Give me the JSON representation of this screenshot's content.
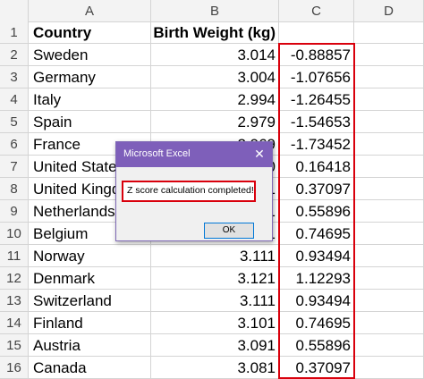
{
  "columns": [
    "A",
    "B",
    "C",
    "D"
  ],
  "rows": [
    {
      "num": "1",
      "a": "Country",
      "b": "Birth Weight (kg)",
      "c": ""
    },
    {
      "num": "2",
      "a": "Sweden",
      "b": "3.014",
      "c": "-0.88857"
    },
    {
      "num": "3",
      "a": "Germany",
      "b": "3.004",
      "c": "-1.07656"
    },
    {
      "num": "4",
      "a": "Italy",
      "b": "2.994",
      "c": "-1.26455"
    },
    {
      "num": "5",
      "a": "Spain",
      "b": "2.979",
      "c": "-1.54653"
    },
    {
      "num": "6",
      "a": "France",
      "b": "2.969",
      "c": "-1.73452"
    },
    {
      "num": "7",
      "a": "United States",
      "b": "3.060",
      "c": "0.16418"
    },
    {
      "num": "8",
      "a": "United Kingdom",
      "b": "3.071",
      "c": "0.37097"
    },
    {
      "num": "9",
      "a": "Netherlands",
      "b": "3.081",
      "c": "0.55896"
    },
    {
      "num": "10",
      "a": "Belgium",
      "b": "3.091",
      "c": "0.74695"
    },
    {
      "num": "11",
      "a": "Norway",
      "b": "3.111",
      "c": "0.93494"
    },
    {
      "num": "12",
      "a": "Denmark",
      "b": "3.121",
      "c": "1.12293"
    },
    {
      "num": "13",
      "a": "Switzerland",
      "b": "3.111",
      "c": "0.93494"
    },
    {
      "num": "14",
      "a": "Finland",
      "b": "3.101",
      "c": "0.74695"
    },
    {
      "num": "15",
      "a": "Austria",
      "b": "3.091",
      "c": "0.55896"
    },
    {
      "num": "16",
      "a": "Canada",
      "b": "3.081",
      "c": "0.37097"
    }
  ],
  "dialog": {
    "title": "Microsoft Excel",
    "close_glyph": "✕",
    "message": "Z score calculation completed!",
    "ok_label": "OK"
  },
  "colors": {
    "highlight": "#d9000c",
    "title_bar": "#7e5fba"
  }
}
